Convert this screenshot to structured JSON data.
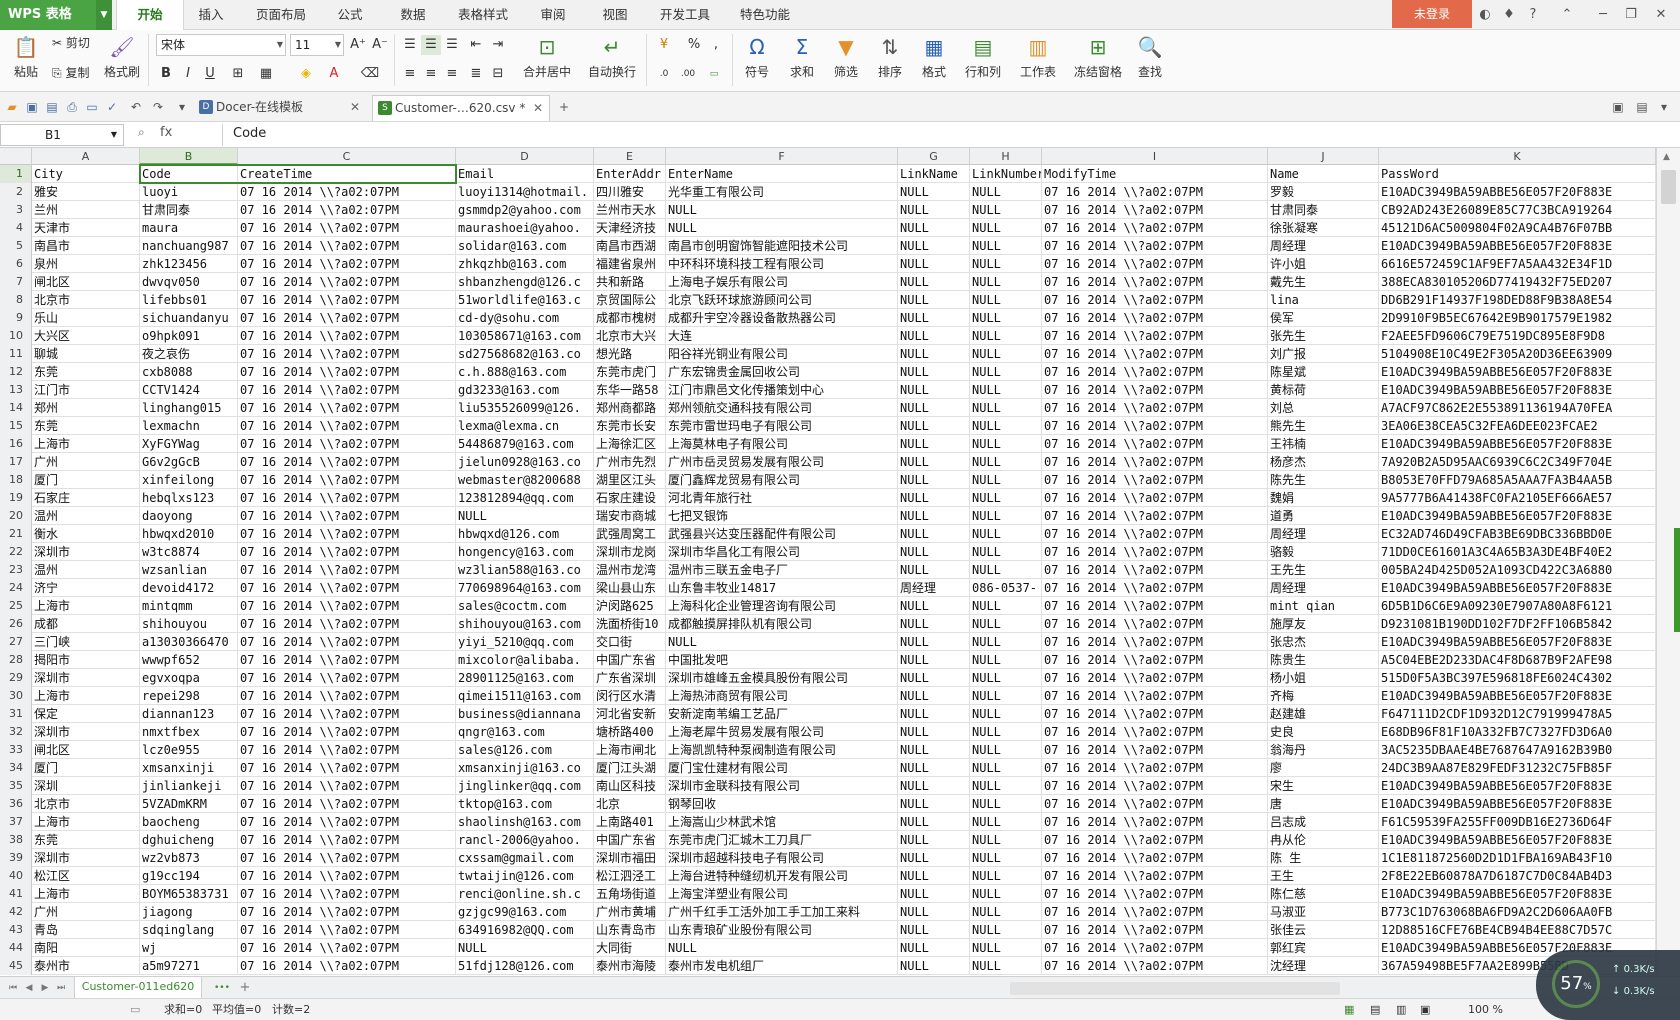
{
  "app": {
    "logo": "WPS 表格",
    "login": "未登录"
  },
  "menu_tabs": [
    "开始",
    "插入",
    "页面布局",
    "公式",
    "数据",
    "表格样式",
    "审阅",
    "视图",
    "开发工具",
    "特色功能"
  ],
  "ribbon": {
    "paste": "粘贴",
    "cut": "剪切",
    "copy": "复制",
    "format_painter": "格式刷",
    "font_name": "宋体",
    "font_size": "11",
    "merge_center": "合并居中",
    "wrap_text": "自动换行",
    "number_format": "%",
    "symbol": "符号",
    "sum": "求和",
    "filter": "筛选",
    "sort": "排序",
    "format": "格式",
    "row_col": "行和列",
    "worksheet": "工作表",
    "freeze": "冻结窗格",
    "find": "查找"
  },
  "doc_tabs": [
    {
      "label": "Docer-在线模板"
    },
    {
      "label": "Customer-…620.csv *"
    }
  ],
  "formula_bar": {
    "cell_ref": "B1",
    "fx": "fx",
    "content": "Code"
  },
  "columns": [
    "A",
    "B",
    "C",
    "D",
    "E",
    "F",
    "G",
    "H",
    "I",
    "J",
    "K"
  ],
  "rows": [
    [
      "1",
      "City",
      "Code",
      "CreateTime",
      "Email",
      "EnterAddr",
      "EnterName",
      "LinkName",
      "LinkNumber",
      "ModifyTime",
      "Name",
      "PassWord"
    ],
    [
      "2",
      "雅安",
      "luoyi",
      "07 16 2014 \\\\?a02:07PM",
      "luoyi1314@hotmail.",
      "四川雅安",
      "光华重工有限公司",
      "NULL",
      "NULL",
      "07 16 2014 \\\\?a02:07PM",
      "罗毅",
      "E10ADC3949BA59ABBE56E057F20F883E"
    ],
    [
      "3",
      "兰州",
      "甘肃同泰",
      "07 16 2014 \\\\?a02:07PM",
      "gsmmdp2@yahoo.com",
      "兰州市天水",
      "NULL",
      "NULL",
      "NULL",
      "07 16 2014 \\\\?a02:07PM",
      "甘肃同泰",
      "CB92AD243E26089E85C77C3BCA919264"
    ],
    [
      "4",
      "天津市",
      "maura",
      "07 16 2014 \\\\?a02:07PM",
      "maurashoei@yahoo.",
      "天津经济技",
      "NULL",
      "NULL",
      "NULL",
      "07 16 2014 \\\\?a02:07PM",
      "徐张凝寒",
      "45121D6AC5009804F02A9CA4B76F07BB"
    ],
    [
      "5",
      "南昌市",
      "nanchuang987",
      "07 16 2014 \\\\?a02:07PM",
      "solidar@163.com",
      "南昌市西湖",
      "南昌市创明窗饰智能遮阳技术公司",
      "NULL",
      "NULL",
      "07 16 2014 \\\\?a02:07PM",
      "周经理",
      "E10ADC3949BA59ABBE56E057F20F883E"
    ],
    [
      "6",
      "泉州",
      "zhk123456",
      "07 16 2014 \\\\?a02:07PM",
      "zhkqzhb@163.com",
      "福建省泉州",
      "中环科环境科技工程有限公司",
      "NULL",
      "NULL",
      "07 16 2014 \\\\?a02:07PM",
      "许小姐",
      "6616E572459C1AF9EF7A5AA432E34F1D"
    ],
    [
      "7",
      "闸北区",
      "dwvqv050",
      "07 16 2014 \\\\?a02:07PM",
      "shbanzhengd@126.c",
      "共和新路",
      "上海电子娱乐有限公司",
      "NULL",
      "NULL",
      "07 16 2014 \\\\?a02:07PM",
      "戴先生",
      "388ECA830105206D77419432F75ED207"
    ],
    [
      "8",
      "北京市",
      "lifebbs01",
      "07 16 2014 \\\\?a02:07PM",
      "51worldlife@163.c",
      "京贸国际公",
      "北京飞跃环球旅游顾问公司",
      "NULL",
      "NULL",
      "07 16 2014 \\\\?a02:07PM",
      "lina",
      "DD6B291F14937F198DED88F9B38A8E54"
    ],
    [
      "9",
      "乐山",
      "sichuandanyu",
      "07 16 2014 \\\\?a02:07PM",
      "cd-dy@sohu.com",
      "成都市槐树",
      "成都升宇空冷器设备散热器公司",
      "NULL",
      "NULL",
      "07 16 2014 \\\\?a02:07PM",
      "侯军",
      "2D9910F9B5EC67642E9B9017579E1982"
    ],
    [
      "10",
      "大兴区",
      "o9hpk091",
      "07 16 2014 \\\\?a02:07PM",
      "103058671@163.com",
      "北京市大兴",
      "大连",
      "NULL",
      "NULL",
      "07 16 2014 \\\\?a02:07PM",
      "张先生",
      "F2AEE5FD9606C79E7519DC895E8F9D8"
    ],
    [
      "11",
      "聊城",
      "夜之哀伤",
      "07 16 2014 \\\\?a02:07PM",
      "sd27568682@163.co",
      "想光路",
      "阳谷祥光铜业有限公司",
      "NULL",
      "NULL",
      "07 16 2014 \\\\?a02:07PM",
      "刘广报",
      "5104908E10C49E2F305A20D36EE63909"
    ],
    [
      "12",
      "东莞",
      "cxb8088",
      "07 16 2014 \\\\?a02:07PM",
      "c.h.888@163.com",
      "东莞市虎门",
      "广东宏锦贵金属回收公司",
      "NULL",
      "NULL",
      "07 16 2014 \\\\?a02:07PM",
      "陈星斌",
      "E10ADC3949BA59ABBE56E057F20F883E"
    ],
    [
      "13",
      "江门市",
      "CCTV1424",
      "07 16 2014 \\\\?a02:07PM",
      "gd3233@163.com",
      "东华一路58",
      "江门市鼎邑文化传播策划中心",
      "NULL",
      "NULL",
      "07 16 2014 \\\\?a02:07PM",
      "黄标荷",
      "E10ADC3949BA59ABBE56E057F20F883E"
    ],
    [
      "14",
      "郑州",
      "linghang015",
      "07 16 2014 \\\\?a02:07PM",
      "liu535526099@126.",
      "郑州商都路",
      "郑州领航交通科技有限公司",
      "NULL",
      "NULL",
      "07 16 2014 \\\\?a02:07PM",
      "刘总",
      "A7ACF97C862E2E553891136194A70FEA"
    ],
    [
      "15",
      "东莞",
      "lexmachn",
      "07 16 2014 \\\\?a02:07PM",
      "lexma@lexma.cn",
      "东莞市长安",
      "东莞市雷世玛电子有限公司",
      "NULL",
      "NULL",
      "07 16 2014 \\\\?a02:07PM",
      "熊先生",
      "3EA06E38CEA5C32FEA6DEE023FCAE2"
    ],
    [
      "16",
      "上海市",
      "XyFGYWag",
      "07 16 2014 \\\\?a02:07PM",
      "54486879@163.com",
      "上海徐汇区",
      "上海莫林电子有限公司",
      "NULL",
      "NULL",
      "07 16 2014 \\\\?a02:07PM",
      "王祎楠",
      "E10ADC3949BA59ABBE56E057F20F883E"
    ],
    [
      "17",
      "广州",
      "G6v2gGcB",
      "07 16 2014 \\\\?a02:07PM",
      "jielun0928@163.co",
      "广州市先烈",
      "广州市岳灵贸易发展有限公司",
      "NULL",
      "NULL",
      "07 16 2014 \\\\?a02:07PM",
      "杨彦杰",
      "7A920B2A5D95AAC6939C6C2C349F704E"
    ],
    [
      "18",
      "厦门",
      "xinfeilong",
      "07 16 2014 \\\\?a02:07PM",
      "webmaster@8200688",
      "湖里区江头",
      "厦门鑫辉龙贸易有限公司",
      "NULL",
      "NULL",
      "07 16 2014 \\\\?a02:07PM",
      "陈先生",
      "B8053E70FFD79A685A5AAA7FA3B4AA5B"
    ],
    [
      "19",
      "石家庄",
      "hebqlxs123",
      "07 16 2014 \\\\?a02:07PM",
      "123812894@qq.com",
      "石家庄建设",
      "河北青年旅行社",
      "NULL",
      "NULL",
      "07 16 2014 \\\\?a02:07PM",
      "魏娟",
      "9A5777B6A41438FC0FA2105EF666AE57"
    ],
    [
      "20",
      "温州",
      "daoyong",
      "07 16 2014 \\\\?a02:07PM",
      "NULL",
      "瑞安市商城",
      "七把叉银饰",
      "NULL",
      "NULL",
      "07 16 2014 \\\\?a02:07PM",
      "道勇",
      "E10ADC3949BA59ABBE56E057F20F883E"
    ],
    [
      "21",
      "衡水",
      "hbwqxd2010",
      "07 16 2014 \\\\?a02:07PM",
      "hbwqxd@126.com",
      "武强周窝工",
      "武强县兴达变压器配件有限公司",
      "NULL",
      "NULL",
      "07 16 2014 \\\\?a02:07PM",
      "周经理",
      "EC32AD746D49CFAB3BE69DBC336BBD0E"
    ],
    [
      "22",
      "深圳市",
      "w3tc8874",
      "07 16 2014 \\\\?a02:07PM",
      "hongency@163.com",
      "深圳市龙岗",
      "深圳市华昌化工有限公司",
      "NULL",
      "NULL",
      "07 16 2014 \\\\?a02:07PM",
      "骆毅",
      "71DD0CE61601A3C4A65B3A3DE4BF40E2"
    ],
    [
      "23",
      "温州",
      "wzsanlian",
      "07 16 2014 \\\\?a02:07PM",
      "wz3lian588@163.co",
      "温州市龙湾",
      "温州市三联五金电子厂",
      "NULL",
      "NULL",
      "07 16 2014 \\\\?a02:07PM",
      "王先生",
      "005BA24D425D052A1093CD422C3A6880"
    ],
    [
      "24",
      "济宁",
      "devoid4172",
      "07 16 2014 \\\\?a02:07PM",
      "770698964@163.com",
      "梁山县山东",
      "山东鲁丰牧业14817",
      "周经理",
      "086-0537-",
      "07 16 2014 \\\\?a02:07PM",
      "周经理",
      "E10ADC3949BA59ABBE56E057F20F883E"
    ],
    [
      "25",
      "上海市",
      "mintqmm",
      "07 16 2014 \\\\?a02:07PM",
      "sales@coctm.com",
      "沪闵路625",
      "上海科化企业管理咨询有限公司",
      "NULL",
      "NULL",
      "07 16 2014 \\\\?a02:07PM",
      "mint qian",
      "6D5B1D6C6E9A09230E7907A80A8F6121"
    ],
    [
      "26",
      "成都",
      "shihouyou",
      "07 16 2014 \\\\?a02:07PM",
      "shihouyou@163.com",
      "洗面桥街10",
      "成都触摸屏排队机有限公司",
      "NULL",
      "NULL",
      "07 16 2014 \\\\?a02:07PM",
      "施厚友",
      "D9231081B190DD102F7DF2FF106B5842"
    ],
    [
      "27",
      "三门峡",
      "a13030366470",
      "07 16 2014 \\\\?a02:07PM",
      "yiyi_5210@qq.com",
      "交口街",
      "NULL",
      "NULL",
      "NULL",
      "07 16 2014 \\\\?a02:07PM",
      "张忠杰",
      "E10ADC3949BA59ABBE56E057F20F883E"
    ],
    [
      "28",
      "揭阳市",
      "wwwpf652",
      "07 16 2014 \\\\?a02:07PM",
      "mixcolor@alibaba.",
      "中国广东省",
      "中国批发吧",
      "NULL",
      "NULL",
      "07 16 2014 \\\\?a02:07PM",
      "陈贵生",
      "A5C04EBE2D233DAC4F8D687B9F2AFE98"
    ],
    [
      "29",
      "深圳市",
      "egvxoqpa",
      "07 16 2014 \\\\?a02:07PM",
      "28901125@163.com",
      "广东省深圳",
      "深圳市雄峰五金模具股份有限公司",
      "NULL",
      "NULL",
      "07 16 2014 \\\\?a02:07PM",
      "杨小姐",
      "515D0F5A3BC397E596818FE6024C4302"
    ],
    [
      "30",
      "上海市",
      "repei298",
      "07 16 2014 \\\\?a02:07PM",
      "qimei1511@163.com",
      "闵行区水清",
      "上海热沛商贸有限公司",
      "NULL",
      "NULL",
      "07 16 2014 \\\\?a02:07PM",
      "齐梅",
      "E10ADC3949BA59ABBE56E057F20F883E"
    ],
    [
      "31",
      "保定",
      "diannan123",
      "07 16 2014 \\\\?a02:07PM",
      "business@diannana",
      "河北省安新",
      "安新淀南苇编工艺品厂",
      "NULL",
      "NULL",
      "07 16 2014 \\\\?a02:07PM",
      "赵建雄",
      "F647111D2CDF1D932D12C791999478A5"
    ],
    [
      "32",
      "深圳市",
      "nmxtfbex",
      "07 16 2014 \\\\?a02:07PM",
      "qngr@163.com",
      "塘桥路400",
      "上海老犀牛贸易发展有限公司",
      "NULL",
      "NULL",
      "07 16 2014 \\\\?a02:07PM",
      "史良",
      "E68DB96F81F10A332FB7C7327FD3D6A0"
    ],
    [
      "33",
      "闸北区",
      "lcz0e955",
      "07 16 2014 \\\\?a02:07PM",
      "sales@126.com",
      "上海市闸北",
      "上海凯凯特种泵阀制造有限公司",
      "NULL",
      "NULL",
      "07 16 2014 \\\\?a02:07PM",
      "翁海丹",
      "3AC5235DBAAE4BE7687647A9162B39B0"
    ],
    [
      "34",
      "厦门",
      "xmsanxinji",
      "07 16 2014 \\\\?a02:07PM",
      "xmsanxinji@163.co",
      "厦门江头湖",
      "厦门宝仕建材有限公司",
      "NULL",
      "NULL",
      "07 16 2014 \\\\?a02:07PM",
      "廖",
      "24DC3B9AA87E829FEDF31232C75FB85F"
    ],
    [
      "35",
      "深圳",
      "jinliankeji",
      "07 16 2014 \\\\?a02:07PM",
      "jinglinker@qq.com",
      "南山区科技",
      "深圳市金联科技有限公司",
      "NULL",
      "NULL",
      "07 16 2014 \\\\?a02:07PM",
      "宋生",
      "E10ADC3949BA59ABBE56E057F20F883E"
    ],
    [
      "36",
      "北京市",
      "5VZADmKRM",
      "07 16 2014 \\\\?a02:07PM",
      "tktop@163.com",
      "北京",
      "钢琴回收",
      "NULL",
      "NULL",
      "07 16 2014 \\\\?a02:07PM",
      "唐",
      "E10ADC3949BA59ABBE56E057F20F883E"
    ],
    [
      "37",
      "上海市",
      "baocheng",
      "07 16 2014 \\\\?a02:07PM",
      "shaolinsh@163.com",
      "上南路401",
      "上海嵩山少林武术馆",
      "NULL",
      "NULL",
      "07 16 2014 \\\\?a02:07PM",
      "吕志成",
      "F61C59539FA255FF009DB16E2736D64F"
    ],
    [
      "38",
      "东莞",
      "dghuicheng",
      "07 16 2014 \\\\?a02:07PM",
      "rancl-2006@yahoo.",
      "中国广东省",
      "东莞市虎门汇城木工刀具厂",
      "NULL",
      "NULL",
      "07 16 2014 \\\\?a02:07PM",
      "冉从伦",
      "E10ADC3949BA59ABBE56E057F20F883E"
    ],
    [
      "39",
      "深圳市",
      "wz2vb873",
      "07 16 2014 \\\\?a02:07PM",
      "cxssam@gmail.com",
      "深圳市福田",
      "深圳市超越科技电子有限公司",
      "NULL",
      "NULL",
      "07 16 2014 \\\\?a02:07PM",
      "陈 生",
      "1C1E811872560D2D1D1FBA169AB43F10"
    ],
    [
      "40",
      "松江区",
      "g19cc194",
      "07 16 2014 \\\\?a02:07PM",
      "twtaijin@126.com",
      "松江泗泾工",
      "上海台进特种缝纫机开发有限公司",
      "NULL",
      "NULL",
      "07 16 2014 \\\\?a02:07PM",
      "王生",
      "2F8E22EB60878A7D6187C7D0C84AB4D3"
    ],
    [
      "41",
      "上海市",
      "BOYM65383731",
      "07 16 2014 \\\\?a02:07PM",
      "renci@online.sh.c",
      "五角场街道",
      "上海宝洋塑业有限公司",
      "NULL",
      "NULL",
      "07 16 2014 \\\\?a02:07PM",
      "陈仁慈",
      "E10ADC3949BA59ABBE56E057F20F883E"
    ],
    [
      "42",
      "广州",
      "jiagong",
      "07 16 2014 \\\\?a02:07PM",
      "gzjgc99@163.com",
      "广州市黄埔",
      "广州千红手工活外加工手工加工来料",
      "NULL",
      "NULL",
      "07 16 2014 \\\\?a02:07PM",
      "马淑亚",
      "B773C1D763068BA6FD9A2C2D606AA0FB"
    ],
    [
      "43",
      "青岛",
      "sdqinglang",
      "07 16 2014 \\\\?a02:07PM",
      "634916982@QQ.com",
      "山东青岛市",
      "山东青琅矿业股份有限公司",
      "NULL",
      "NULL",
      "07 16 2014 \\\\?a02:07PM",
      "张佳云",
      "12D88516CFE76BE4CB94B4EE88C7D57C"
    ],
    [
      "44",
      "南阳",
      "wj",
      "07 16 2014 \\\\?a02:07PM",
      "NULL",
      "大同街",
      "NULL",
      "NULL",
      "NULL",
      "07 16 2014 \\\\?a02:07PM",
      "郭红宾",
      "E10ADC3949BA59ABBE56E057F20F883E"
    ],
    [
      "45",
      "泰州市",
      "a5m97271",
      "07 16 2014 \\\\?a02:07PM",
      "51fdj128@126.com",
      "泰州市海陵",
      "泰州市发电机组厂",
      "NULL",
      "NULL",
      "07 16 2014 \\\\?a02:07PM",
      "沈经理",
      "367A59498BE5F7AA2E899B55BD"
    ]
  ],
  "sheet": {
    "tab": "Customer-011ed620",
    "add": "+"
  },
  "status": {
    "sum": "求和=0",
    "avg": "平均值=0",
    "count": "计数=2",
    "zoom": "100 %"
  },
  "speed": {
    "percent": "57",
    "up": "0.3K/s",
    "down": "0.3K/s"
  }
}
